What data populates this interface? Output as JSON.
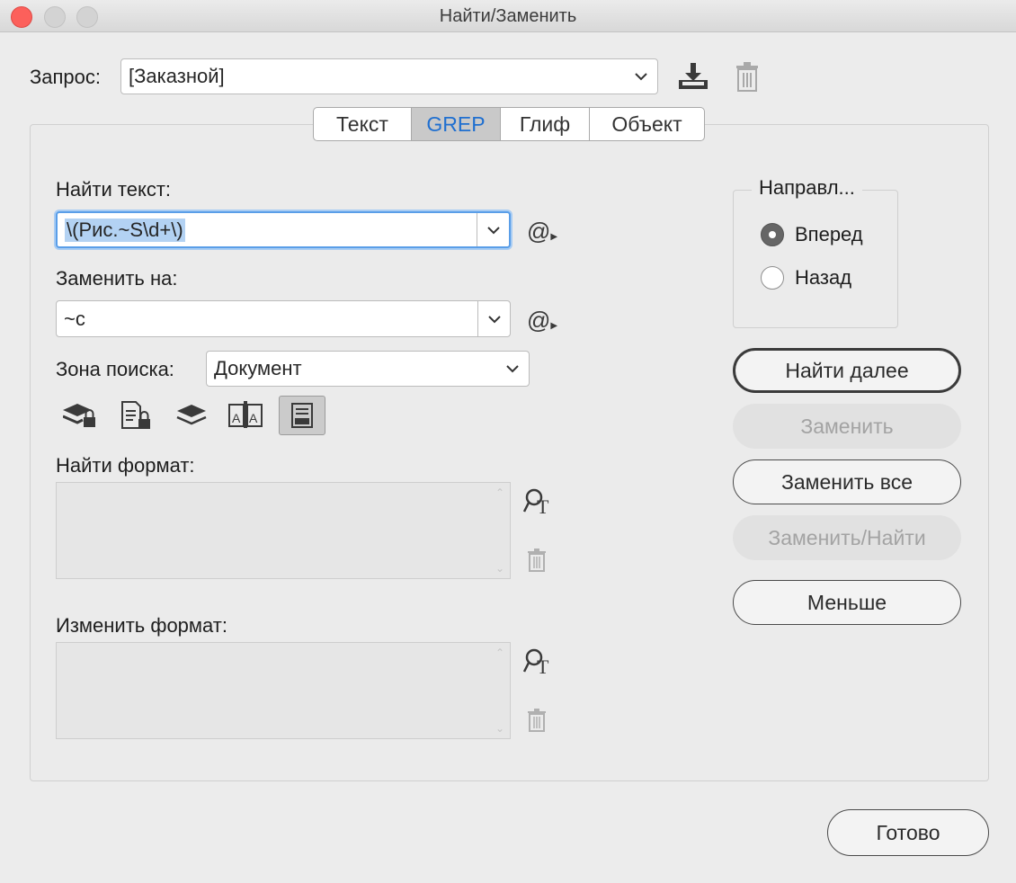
{
  "window": {
    "title": "Найти/Заменить"
  },
  "query": {
    "label": "Запрос:",
    "value": "[Заказной]"
  },
  "tabs": [
    {
      "label": "Текст"
    },
    {
      "label": "GREP"
    },
    {
      "label": "Глиф"
    },
    {
      "label": "Объект"
    }
  ],
  "find": {
    "label": "Найти текст:",
    "value": "\\(Рис.~S\\d+\\)"
  },
  "replace": {
    "label": "Заменить на:",
    "value": "~c"
  },
  "search_zone": {
    "label": "Зона поиска:",
    "value": "Документ"
  },
  "find_format": {
    "label": "Найти формат:"
  },
  "change_format": {
    "label": "Изменить формат:"
  },
  "direction": {
    "title": "Направл...",
    "options": [
      {
        "label": "Вперед",
        "checked": true
      },
      {
        "label": "Назад",
        "checked": false
      }
    ]
  },
  "buttons": {
    "find_next": "Найти далее",
    "replace": "Заменить",
    "replace_all": "Заменить все",
    "replace_find": "Заменить/Найти",
    "less": "Меньше",
    "done": "Готово"
  },
  "colors": {
    "accent": "#1f6fd0",
    "selection": "#b3d2f3",
    "close": "#fc605b"
  }
}
